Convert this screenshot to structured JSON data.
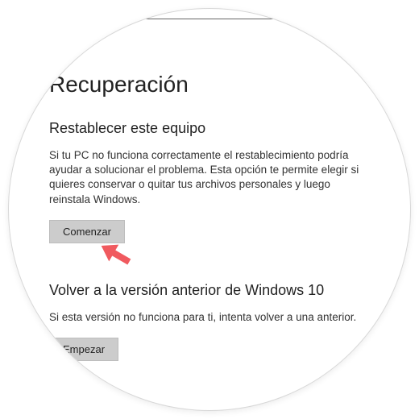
{
  "page": {
    "title": "Recuperación"
  },
  "reset": {
    "heading": "Restablecer este equipo",
    "description": "Si tu PC no funciona correctamente el restablecimiento podría ayudar a solucionar el problema. Esta opción te permite elegir si quieres conservar o quitar tus archivos personales y luego reinstala Windows.",
    "button_label": "Comenzar"
  },
  "rollback": {
    "heading": "Volver a la versión anterior de Windows 10",
    "description": "Si esta versión no funciona para ti, intenta volver a una anterior.",
    "button_label": "Empezar"
  }
}
